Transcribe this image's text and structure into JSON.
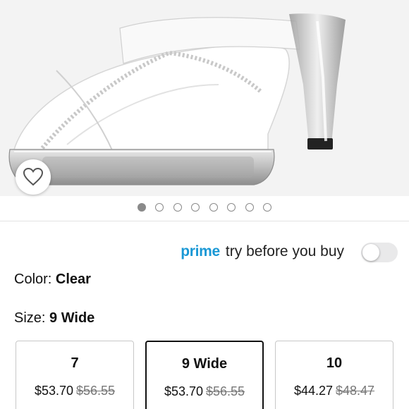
{
  "product_image": {
    "alt": "Clear rhinestone strap platform sandal",
    "current_slide": 1,
    "total_slides": 8
  },
  "wishlist": {
    "icon": "heart-outline-icon"
  },
  "prime": {
    "brand": "prime",
    "text": "try before you buy",
    "toggle_on": false
  },
  "color": {
    "label": "Color:",
    "value": "Clear"
  },
  "size": {
    "label": "Size:",
    "value": "9 Wide"
  },
  "size_options": [
    {
      "size": "7",
      "price": "$53.70",
      "list_price": "$56.55",
      "selected": false
    },
    {
      "size": "9 Wide",
      "price": "$53.70",
      "list_price": "$56.55",
      "selected": true
    },
    {
      "size": "10",
      "price": "$44.27",
      "list_price": "$48.47",
      "selected": false
    }
  ],
  "colors": {
    "prime_blue": "#1a98d5",
    "dot_active": "#8a8a8a"
  }
}
